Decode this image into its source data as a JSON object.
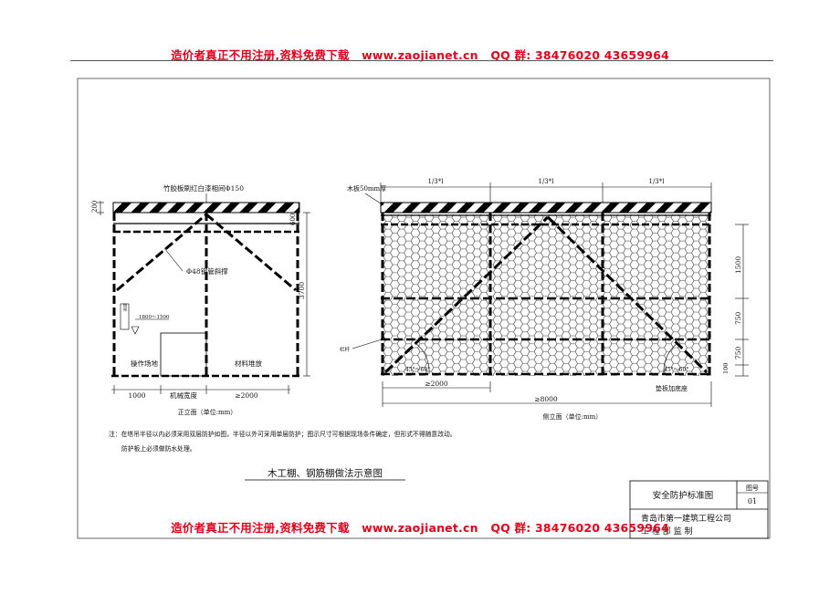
{
  "banner": {
    "text": "造价者真正不用注册,资料免费下载   www.zaojianet.cn   QQ 群: 38476020 43659964",
    "color": "#e0001b"
  },
  "front": {
    "top_label": "竹胶板刷红白漆相间Φ150",
    "brace_label": "Φ48钢管斜撑",
    "dim_200": "200",
    "dim_600": "600",
    "dim_3700": "3700",
    "tower_label": "塔吊",
    "dim_1800": "1800～1500",
    "work_area": "操作场地",
    "material_area": "材料堆放",
    "dim_1000": "1000",
    "machine_width": "机械宽度",
    "dim_2000": "≥2000",
    "caption": "正立面（单位:mm）"
  },
  "side": {
    "board_label": "木板50mm厚",
    "segment": "1/3*l",
    "rail_label": "栏杆",
    "dim_1500": "1500",
    "dim_750a": "750",
    "dim_750b": "750",
    "dim_100": "100",
    "angle": "45°～60°",
    "dim_2000": "≥2000",
    "base_label": "垫板加底座",
    "dim_8000": "≥8000",
    "caption": "侧立面（单位:mm）"
  },
  "notes": {
    "line1": "注：在塔吊半径以内必须采用双层防护如图，半径以外可采用单层防护；图示尺寸可根据现场条件确定，但形式不得随意改动。",
    "line2": "防护板上必须做防水处理。"
  },
  "title": "木工棚、钢筋棚做法示意图",
  "title_block": {
    "name": "安全防护标准图",
    "drawing_no_label": "图号",
    "drawing_no": "01",
    "company": "青岛市第一建筑工程公司",
    "department": "工 程 部 监 制"
  }
}
